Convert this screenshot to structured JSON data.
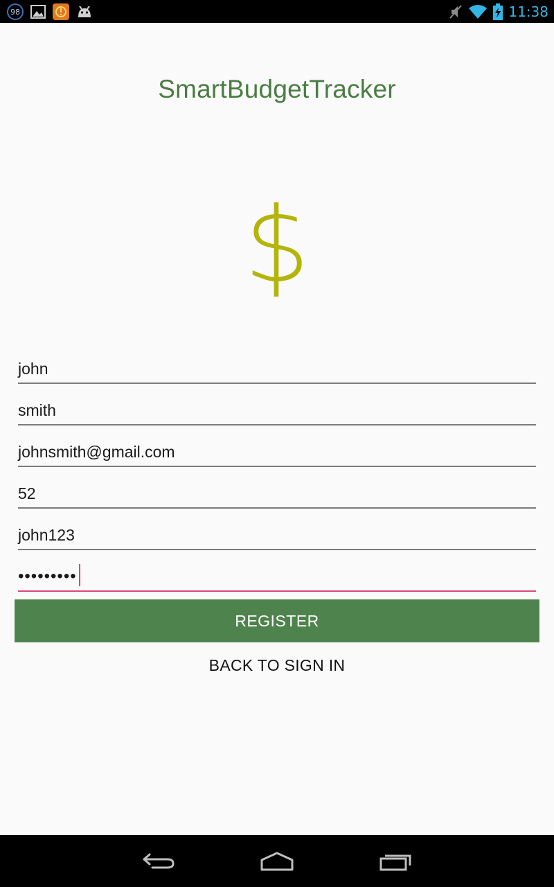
{
  "status_bar": {
    "notification_count": "98",
    "time": "11:38",
    "icons": [
      "notification-count-icon",
      "image-icon",
      "warning-app-icon",
      "android-icon",
      "mute-icon",
      "wifi-icon",
      "battery-charging-icon"
    ]
  },
  "app": {
    "title": "SmartBudgetTracker",
    "logo_symbol": "$",
    "accent_color": "#4f834d",
    "logo_color": "#b4b40a"
  },
  "form": {
    "first_name": "john",
    "last_name": "smith",
    "email": "johnsmith@gmail.com",
    "age": "52",
    "username": "john123",
    "password_masked": "•••••••••",
    "register_label": "REGISTER",
    "back_label": "BACK TO SIGN IN"
  },
  "nav_bar": {
    "icons": [
      "back-icon",
      "home-icon",
      "recent-apps-icon"
    ]
  }
}
